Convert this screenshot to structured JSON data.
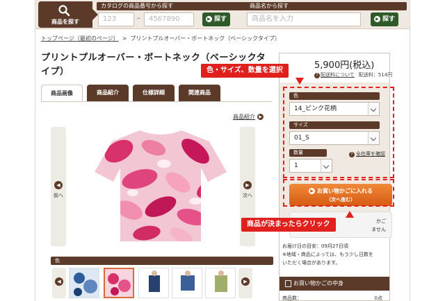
{
  "header": {
    "search_tab_label": "商品を探す",
    "catalog_label": "カタログの商品番号から探す",
    "catalog_input1_placeholder": "123",
    "catalog_input2_placeholder": "4567890",
    "search_button": "探す",
    "name_label": "商品名から探す",
    "name_input_placeholder": "商品名を入力",
    "name_search_button": "探す"
  },
  "breadcrumb": {
    "home": "トップページ（最初のページ）",
    "separator": ">",
    "current": "プリントプルオーバー・ボートネック（ベーシックタイプ）"
  },
  "product": {
    "title_line1": "プリントプルオーバー・ボートネック（ベーシックタ",
    "title_line2": "イプ）"
  },
  "tabs": [
    "商品画像",
    "商品紹介",
    "仕様詳細",
    "関連商品"
  ],
  "image_area": {
    "description_link": "商品紹介",
    "prev_label": "前へ",
    "next_label": "次へ",
    "color_bar_label": "色"
  },
  "panel": {
    "price": "5,900円(税込)",
    "shipping_link": "配送料について",
    "shipping_fee": "配送料：514円",
    "color_label": "色",
    "color_value": "14_ピンク花柄",
    "size_label": "サイズ",
    "size_value": "01_S",
    "qty_label": "数量",
    "qty_value": "1",
    "stock_link": "全在庫を確認",
    "cart_button_line1": "お買い物かごに入れる",
    "cart_button_line2": "（次へ進む）",
    "hidden_button_tail1": "かご",
    "hidden_button_tail2": "ません",
    "delivery_line1": "お届け日の目安：09月27日頃",
    "delivery_line2": "※地域・商品によっては、もう少し日数を",
    "delivery_line3": "いただく場合があります。",
    "cart_contents_header": "お買い物かごの中身",
    "cart_count_label": "商品数：",
    "cart_count_value": "0点"
  },
  "annotations": {
    "select_callout": "色・サイズ、数量を選択",
    "click_callout": "商品が決まったらクリック"
  },
  "colors": {
    "brand_brown": "#5b3a29",
    "green_button": "#2f5b2a",
    "cart_orange": "#e2691f",
    "annotation_red": "#e0201d"
  }
}
